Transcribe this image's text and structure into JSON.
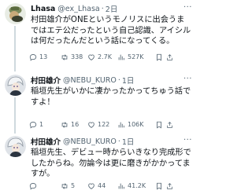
{
  "tweets": [
    {
      "name": "Lhasa",
      "handle": "@ex_Lhasa",
      "separator": "·",
      "time": "2日",
      "text": "村田雄介がONEというモノリスに出会うまではエテ公だったという自己認識、アイシルは何だったんだという話になってくる。",
      "replies": "13",
      "reposts": "338",
      "likes": "2.7K",
      "views": "527K"
    },
    {
      "name": "村田雄介",
      "handle": "@NEBU_KURO",
      "separator": "·",
      "time": "1日",
      "text": "稲垣先生がいかに凄かったかってちゅう話ですよ！",
      "replies": "1",
      "reposts": "16",
      "likes": "122",
      "views": "106K"
    },
    {
      "name": "村田雄介",
      "handle": "@NEBU_KURO",
      "separator": "·",
      "time": "1日",
      "text": "稲垣先生、デビュー時からいきなり完成形でしたからね。勿論今は更に磨きがかかってますが。",
      "replies": "",
      "reposts": "5",
      "likes": "44",
      "views": "41.2K"
    }
  ],
  "icons": {
    "reply": "reply-icon",
    "repost": "repost-icon",
    "like": "heart-icon",
    "views": "views-chart-icon",
    "bookmark": "bookmark-icon",
    "share": "share-icon",
    "more": "more-icon"
  },
  "more_glyph": "···",
  "colors": {
    "text": "#0f1419",
    "secondary": "#536471",
    "thread_line": "#cfd9de"
  }
}
